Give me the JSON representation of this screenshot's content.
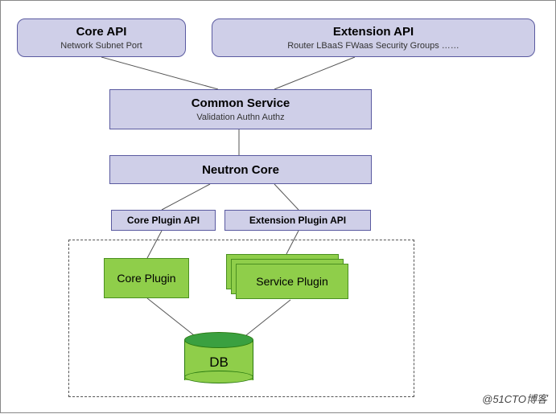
{
  "core_api": {
    "title": "Core API",
    "sub": "Network   Subnet   Port"
  },
  "ext_api": {
    "title": "Extension API",
    "sub": "Router      LBaaS      FWaas      Security Groups ……"
  },
  "common_service": {
    "title": "Common Service",
    "sub": "Validation      Authn       Authz"
  },
  "neutron_core": {
    "title": "Neutron Core"
  },
  "core_plugin_api": {
    "title": "Core Plugin API"
  },
  "ext_plugin_api": {
    "title": "Extension Plugin API"
  },
  "core_plugin": {
    "label": "Core Plugin"
  },
  "service_plugin": {
    "label": "Service Plugin"
  },
  "db": {
    "label": "DB"
  },
  "watermark": "@51CTO博客"
}
